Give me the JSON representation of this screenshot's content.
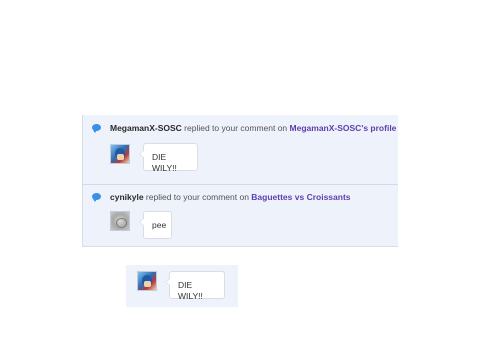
{
  "notifications": [
    {
      "username": "MegamanX-SOSC",
      "action": " replied to your comment on ",
      "target": "MegamanX-SOSC's profile",
      "avatar": "megaman-avatar",
      "comment": "DIE WILY!!"
    },
    {
      "username": "cynikyle",
      "action": " replied to your comment on ",
      "target": "Baguettes vs Croissants",
      "avatar": "cynikyle-avatar",
      "comment": "pee"
    }
  ],
  "reply_preview": {
    "avatar": "megaman-avatar",
    "comment": "DIE WILY!!"
  },
  "colors": {
    "notification_bg": "#eef2fb",
    "link": "#5c3fb0",
    "comment_icon": "#3a8fe6"
  }
}
